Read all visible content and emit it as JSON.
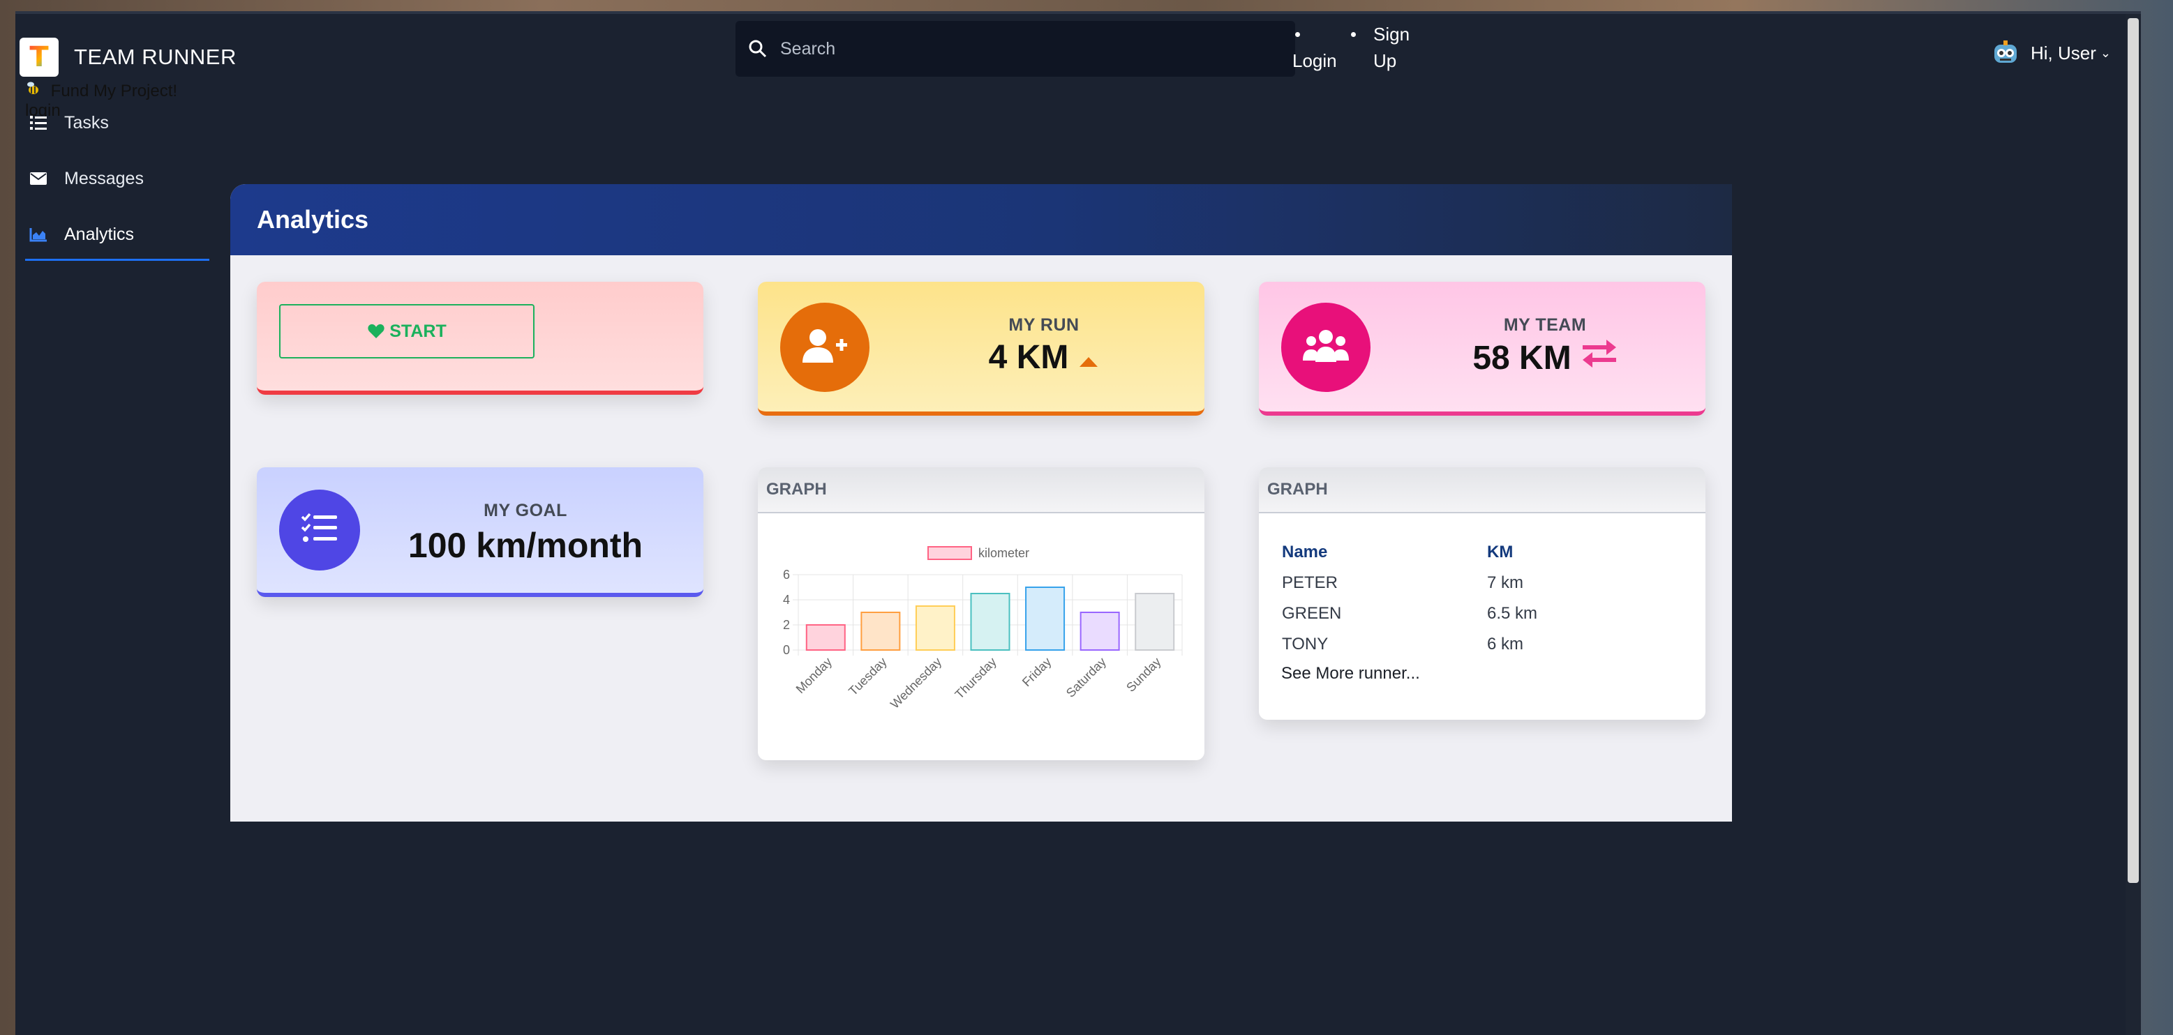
{
  "brand": {
    "name": "TEAM RUNNER",
    "logo_letter": "T"
  },
  "fund": {
    "text": "Fund My Project!",
    "login": "login"
  },
  "sidebar": {
    "items": [
      {
        "label": "Tasks",
        "icon": "tasks-icon"
      },
      {
        "label": "Messages",
        "icon": "envelope-icon"
      },
      {
        "label": "Analytics",
        "icon": "area-chart-icon",
        "active": true
      }
    ]
  },
  "search": {
    "placeholder": "Search",
    "value": ""
  },
  "auth": {
    "login": "Login",
    "signup": "Sign Up"
  },
  "user": {
    "greeting": "Hi, User"
  },
  "page": {
    "title": "Analytics"
  },
  "cards": {
    "start": {
      "label": "START",
      "color": "#1bb15c"
    },
    "run": {
      "label": "MY RUN",
      "value": "4 KM",
      "trend": "up",
      "color": "#e56d0a"
    },
    "team": {
      "label": "MY TEAM",
      "value": "58 KM",
      "color": "#e8107a"
    },
    "goal": {
      "label": "MY GOAL",
      "value": "100 km/month",
      "color": "#4f46e5"
    }
  },
  "graph_card": {
    "title": "GRAPH"
  },
  "table_card": {
    "title": "GRAPH",
    "headers": [
      "Name",
      "KM"
    ],
    "rows": [
      [
        "PETER",
        "7 km"
      ],
      [
        "GREEN",
        "6.5 km"
      ],
      [
        "TONY",
        "6 km"
      ]
    ],
    "see_more": "See More runner..."
  },
  "chart_data": {
    "type": "bar",
    "categories": [
      "Monday",
      "Tuesday",
      "Wednesday",
      "Thursday",
      "Friday",
      "Saturday",
      "Sunday"
    ],
    "series": [
      {
        "name": "kilometer",
        "values": [
          2,
          3,
          3.5,
          4.5,
          5,
          3,
          4.5
        ]
      }
    ],
    "ylim": [
      0,
      6
    ],
    "yticks": [
      0,
      2,
      4,
      6
    ],
    "grid": true,
    "legend": "top",
    "colors": [
      [
        "#ffd3dd",
        "#ff6384"
      ],
      [
        "#ffe4c8",
        "#ff9f40"
      ],
      [
        "#fff2c8",
        "#ffcd56"
      ],
      [
        "#d6f2f2",
        "#4bc0c0"
      ],
      [
        "#d5ecfb",
        "#36a2eb"
      ],
      [
        "#eadcff",
        "#9966ff"
      ],
      [
        "#eceef0",
        "#c9cbcf"
      ]
    ]
  }
}
